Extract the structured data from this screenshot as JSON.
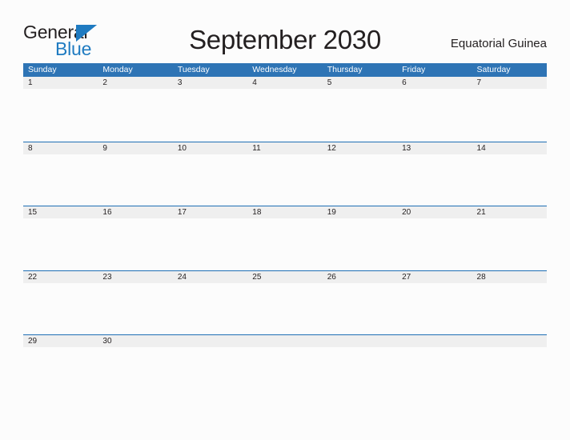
{
  "brand": {
    "name_part1": "General",
    "name_part2": "Blue",
    "flag_icon": "blue-flag-triangle-icon",
    "color_dark": "#231f20",
    "color_blue": "#1f7bc1"
  },
  "header": {
    "title": "September 2030",
    "region": "Equatorial Guinea"
  },
  "colors": {
    "header_blue": "#2e74b5",
    "separator_blue": "#1f6fb5",
    "date_band_gray": "#efefef",
    "page_background": "#fcfcfc",
    "text": "#231f20"
  },
  "calendar": {
    "month": "September",
    "year": "2030",
    "day_headers": [
      "Sunday",
      "Monday",
      "Tuesday",
      "Wednesday",
      "Thursday",
      "Friday",
      "Saturday"
    ],
    "weeks": [
      [
        "1",
        "2",
        "3",
        "4",
        "5",
        "6",
        "7"
      ],
      [
        "8",
        "9",
        "10",
        "11",
        "12",
        "13",
        "14"
      ],
      [
        "15",
        "16",
        "17",
        "18",
        "19",
        "20",
        "21"
      ],
      [
        "22",
        "23",
        "24",
        "25",
        "26",
        "27",
        "28"
      ],
      [
        "29",
        "30",
        "",
        "",
        "",
        "",
        ""
      ]
    ]
  }
}
